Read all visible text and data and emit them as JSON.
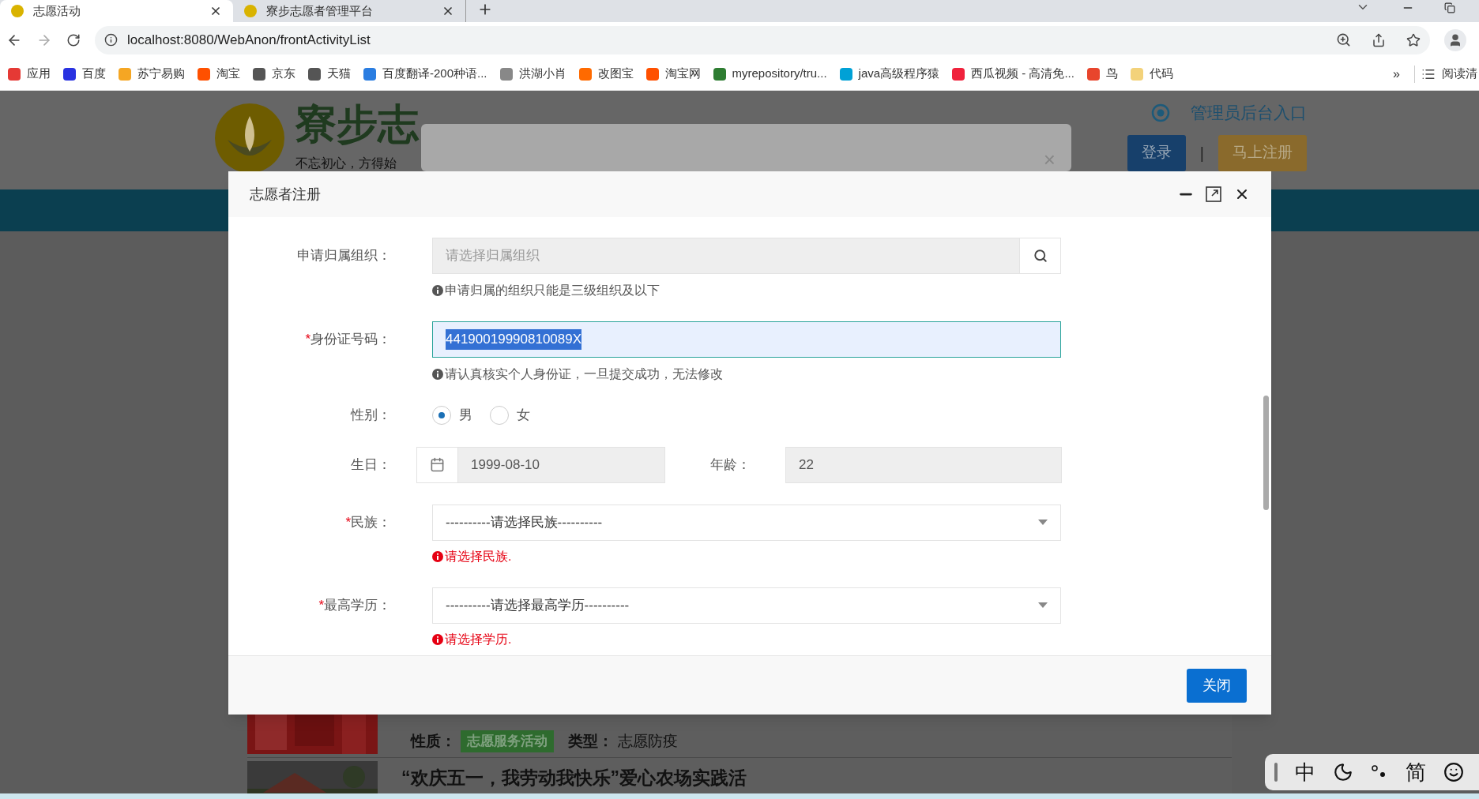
{
  "browser": {
    "tabs": [
      {
        "title": "志愿活动",
        "selected": true
      },
      {
        "title": "寮步志愿者管理平台",
        "selected": false
      }
    ],
    "url": "localhost:8080/WebAnon/frontActivityList",
    "bookmarks": [
      {
        "label": "应用",
        "color": "#e53935"
      },
      {
        "label": "百度",
        "color": "#2932e1"
      },
      {
        "label": "苏宁易购",
        "color": "#f5a623"
      },
      {
        "label": "淘宝",
        "color": "#ff5000"
      },
      {
        "label": "京东",
        "color": "#555555"
      },
      {
        "label": "天猫",
        "color": "#555555"
      },
      {
        "label": "百度翻译-200种语...",
        "color": "#2a7de1"
      },
      {
        "label": "洪湖小肖",
        "color": "#888888"
      },
      {
        "label": "改图宝",
        "color": "#ff6a00"
      },
      {
        "label": "淘宝网",
        "color": "#ff5000"
      },
      {
        "label": "myrepository/tru...",
        "color": "#2e7d32"
      },
      {
        "label": "java高级程序猿",
        "color": "#00a1d6"
      },
      {
        "label": "西瓜视频 - 高清免...",
        "color": "#f0223c"
      },
      {
        "label": "鸟",
        "color": "#e8452c"
      },
      {
        "label": "代码",
        "color": "#f3d27a"
      }
    ],
    "more": "»",
    "reading_list": "阅读清"
  },
  "site": {
    "logo_text": "寮步志",
    "slogan": "不忘初心，方得始",
    "admin_link": "管理员后台入口",
    "login": "登录",
    "separator": "|",
    "register": "马上注册",
    "activities": [
      {
        "props": [
          {
            "label": "性质：",
            "value": "志愿服务活动",
            "kind": "tag"
          },
          {
            "label": "类型：",
            "value": "志愿防疫",
            "kind": "text"
          }
        ]
      },
      {
        "title": "“欢庆五一，我劳动我快乐”爱心农场实践活"
      }
    ]
  },
  "back_dialog": {
    "close": "×"
  },
  "dialog": {
    "title": "志愿者注册",
    "fields": [
      {
        "kind": "lookup",
        "label": "申请归属组织：",
        "placeholder": "请选择归属组织",
        "hint": "申请归属的组织只能是三级组织及以下"
      },
      {
        "kind": "text",
        "label": "身份证号码：",
        "required_mark": "*",
        "value": "44190019990810089X",
        "focused": true,
        "text_selected": true,
        "hint": "请认真核实个人身份证，一旦提交成功，无法修改"
      },
      {
        "kind": "radio",
        "label": "性别：",
        "options": [
          {
            "label": "男",
            "selected": true
          },
          {
            "label": "女",
            "selected": false
          }
        ]
      },
      {
        "kind": "date",
        "label": "生日：",
        "value": "1999-08-10",
        "age_label": "年龄：",
        "age_value": "22"
      },
      {
        "kind": "select",
        "label": "民族：",
        "required_mark": "*",
        "value": "----------请选择民族----------",
        "error": "请选择民族."
      },
      {
        "kind": "select",
        "label": "最高学历：",
        "required_mark": "*",
        "value": "----------请选择最高学历----------",
        "error": "请选择学历."
      }
    ],
    "buttons": [
      {
        "label": "关闭"
      }
    ]
  },
  "ime_toolbar": [
    {
      "kind": "text",
      "label": "中"
    },
    {
      "kind": "moon"
    },
    {
      "kind": "punct"
    },
    {
      "kind": "text",
      "label": "简"
    },
    {
      "kind": "smiley"
    }
  ]
}
